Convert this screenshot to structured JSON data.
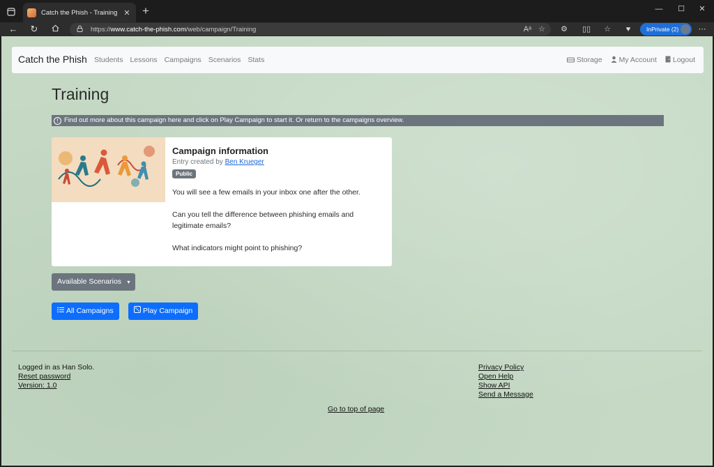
{
  "browser": {
    "tab_title": "Catch the Phish - Training",
    "url_prefix": "https://",
    "url_host": "www.catch-the-phish.com",
    "url_path": "/web/campaign/Training",
    "inprivate_label": "InPrivate (2)"
  },
  "navbar": {
    "brand": "Catch the Phish",
    "links": [
      "Students",
      "Lessons",
      "Campaigns",
      "Scenarios",
      "Stats"
    ],
    "right": {
      "storage": "Storage",
      "account": "My Account",
      "logout": "Logout"
    }
  },
  "page": {
    "title": "Training",
    "info": "Find out more about this campaign here and click on Play Campaign to start it. Or return to the campaigns overview."
  },
  "card": {
    "title": "Campaign information",
    "created_by_prefix": "Entry created by",
    "author": "Ben Krueger",
    "badge": "Public",
    "text1": "You will see a few emails in your inbox one after the other.",
    "text2": "Can you tell the difference between phishing emails and legitimate emails?",
    "text3": "What indicators might point to phishing?"
  },
  "buttons": {
    "scenarios": "Available Scenarios",
    "all_campaigns": "All Campaigns",
    "play_campaign": "Play Campaign"
  },
  "footer": {
    "logged_in": "Logged in as Han Solo.",
    "reset_password": "Reset password",
    "version": "Version: 1.0",
    "privacy": "Privacy Policy",
    "help": "Open Help",
    "api": "Show API",
    "message": "Send a Message",
    "to_top": "Go to top of page"
  },
  "colors": {
    "primary": "#0d6efd",
    "secondary": "#6c757d",
    "page_bg": "#c5d9c5"
  }
}
